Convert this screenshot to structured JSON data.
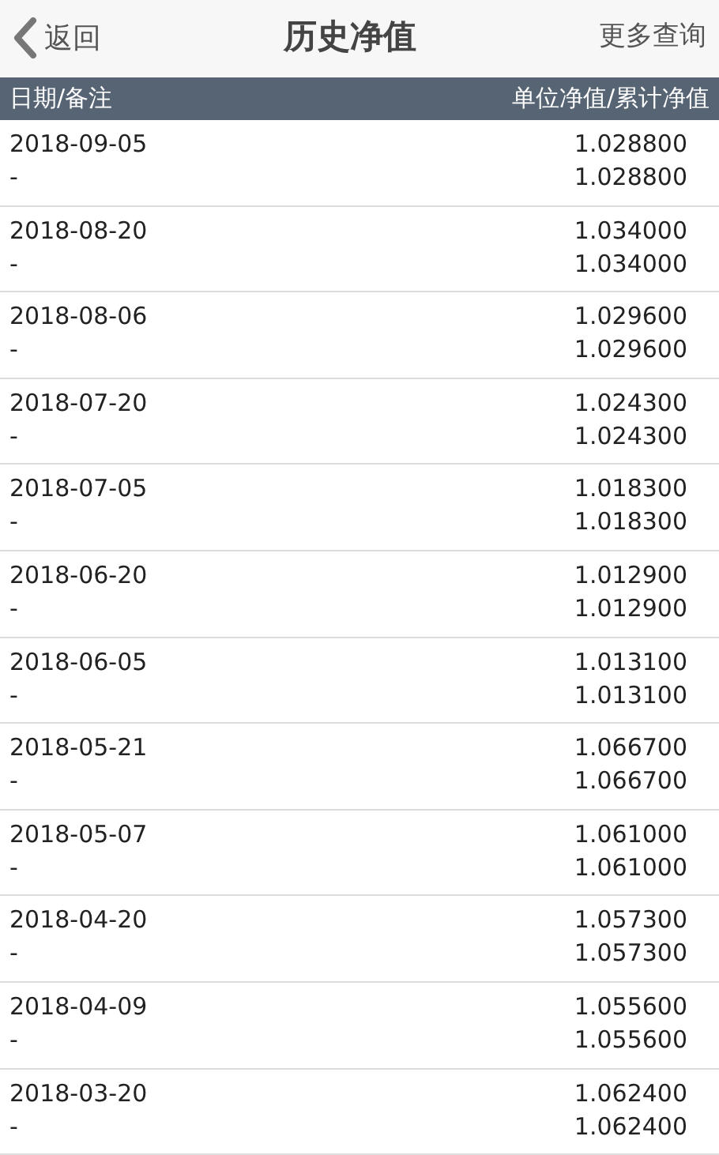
{
  "nav": {
    "back": "返回",
    "title": "历史净值",
    "more": "更多查询"
  },
  "table": {
    "columns": [
      "日期/备注",
      "单位净值/累计净值"
    ],
    "rows": [
      {
        "date": "2018-09-05",
        "note": "-",
        "unit": "1.028800",
        "total": "1.028800"
      },
      {
        "date": "2018-08-20",
        "note": "-",
        "unit": "1.034000",
        "total": "1.034000"
      },
      {
        "date": "2018-08-06",
        "note": "-",
        "unit": "1.029600",
        "total": "1.029600"
      },
      {
        "date": "2018-07-20",
        "note": "-",
        "unit": "1.024300",
        "total": "1.024300"
      },
      {
        "date": "2018-07-05",
        "note": "-",
        "unit": "1.018300",
        "total": "1.018300"
      },
      {
        "date": "2018-06-20",
        "note": "-",
        "unit": "1.012900",
        "total": "1.012900"
      },
      {
        "date": "2018-06-05",
        "note": "-",
        "unit": "1.013100",
        "total": "1.013100"
      },
      {
        "date": "2018-05-21",
        "note": "-",
        "unit": "1.066700",
        "total": "1.066700"
      },
      {
        "date": "2018-05-07",
        "note": "-",
        "unit": "1.061000",
        "total": "1.061000"
      },
      {
        "date": "2018-04-20",
        "note": "-",
        "unit": "1.057300",
        "total": "1.057300"
      },
      {
        "date": "2018-04-09",
        "note": "-",
        "unit": "1.055600",
        "total": "1.055600"
      },
      {
        "date": "2018-03-20",
        "note": "-",
        "unit": "1.062400",
        "total": "1.062400"
      }
    ]
  }
}
